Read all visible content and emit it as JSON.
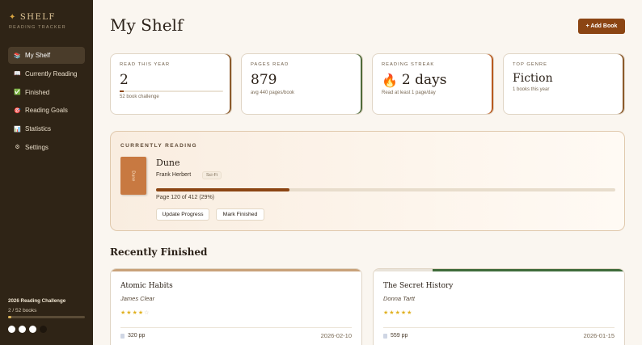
{
  "app": {
    "brand_title": "SHELF",
    "brand_subtitle": "READING TRACKER",
    "brand_icon": "sparkle-icon"
  },
  "sidebar": {
    "items": [
      {
        "label": "My Shelf",
        "icon": "books-icon",
        "glyph": "📚",
        "active": true
      },
      {
        "label": "Currently Reading",
        "icon": "book-open-icon",
        "glyph": "📖",
        "active": false
      },
      {
        "label": "Finished",
        "icon": "checkmark-icon",
        "glyph": "✅",
        "active": false
      },
      {
        "label": "Reading Goals",
        "icon": "target-icon",
        "glyph": "🎯",
        "active": false
      },
      {
        "label": "Statistics",
        "icon": "chart-icon",
        "glyph": "📊",
        "active": false
      },
      {
        "label": "Settings",
        "icon": "gear-icon",
        "glyph": "⚙",
        "active": false
      }
    ],
    "challenge": {
      "title": "2026 Reading Challenge",
      "count_text": "2 / 52 books",
      "progress": 0.038
    }
  },
  "header": {
    "title": "My Shelf",
    "add_button": "+ Add Book"
  },
  "stats": [
    {
      "label": "READ THIS YEAR",
      "value": "2",
      "sub": "52 book challenge",
      "progress": 0.038
    },
    {
      "label": "PAGES READ",
      "value": "879",
      "sub": "avg 440 pages/book"
    },
    {
      "label": "READING STREAK",
      "value": "2 days",
      "sub": "Read at least 1 page/day",
      "icon": "flame-icon"
    },
    {
      "label": "TOP GENRE",
      "value": "Fiction",
      "sub": "1 books this year"
    }
  ],
  "current": {
    "label": "CURRENTLY READING",
    "title": "Dune",
    "cover_text": "Dune",
    "author": "Frank Herbert",
    "genre": "Sci-Fi",
    "progress_text": "Page 120 of 412 (29%)",
    "progress": 0.29,
    "update_button": "Update Progress",
    "finish_button": "Mark Finished"
  },
  "finished": {
    "section_title": "Recently Finished",
    "books": [
      {
        "title": "Atomic Habits",
        "author": "James Clear",
        "rating": 4,
        "pages": "320 pp",
        "date": "2026-02-10",
        "accent": "#c9a27a"
      },
      {
        "title": "The Secret History",
        "author": "Donna Tartt",
        "rating": 5,
        "pages": "559 pp",
        "date": "2026-01-15",
        "accent": "#3f6b3a"
      }
    ]
  },
  "colors": {
    "sidebar_bg": "#2f2416",
    "accent_brown": "#8b4513",
    "star_gold": "#e0b020"
  }
}
